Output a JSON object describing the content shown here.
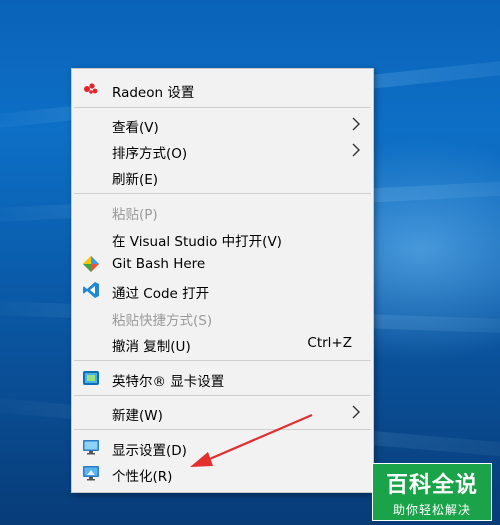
{
  "context_menu": {
    "items": [
      {
        "label": "Radeon 设置",
        "icon": "radeon-icon",
        "disabled": false
      },
      {
        "label": "查看(V)",
        "submenu": true,
        "disabled": false
      },
      {
        "label": "排序方式(O)",
        "submenu": true,
        "disabled": false
      },
      {
        "label": "刷新(E)",
        "disabled": false
      },
      {
        "label": "粘贴(P)",
        "disabled": true
      },
      {
        "label": "在 Visual Studio 中打开(V)",
        "disabled": false
      },
      {
        "label": "Git Bash Here",
        "icon": "git-icon",
        "disabled": false
      },
      {
        "label": "通过 Code 打开",
        "icon": "vscode-icon",
        "disabled": false
      },
      {
        "label": "粘贴快捷方式(S)",
        "disabled": true
      },
      {
        "label": "撤消 复制(U)",
        "shortcut": "Ctrl+Z",
        "disabled": false
      },
      {
        "label": "英特尔® 显卡设置",
        "icon": "intel-graphics-icon",
        "disabled": false
      },
      {
        "label": "新建(W)",
        "submenu": true,
        "disabled": false
      },
      {
        "label": "显示设置(D)",
        "icon": "display-icon",
        "disabled": false
      },
      {
        "label": "个性化(R)",
        "icon": "personalize-icon",
        "disabled": false
      }
    ]
  },
  "watermark": {
    "title": "百科全说",
    "subtitle": "助你轻松解决"
  },
  "colors": {
    "annotation_arrow": "#e23030",
    "watermark_bg": "#1ba34a"
  }
}
